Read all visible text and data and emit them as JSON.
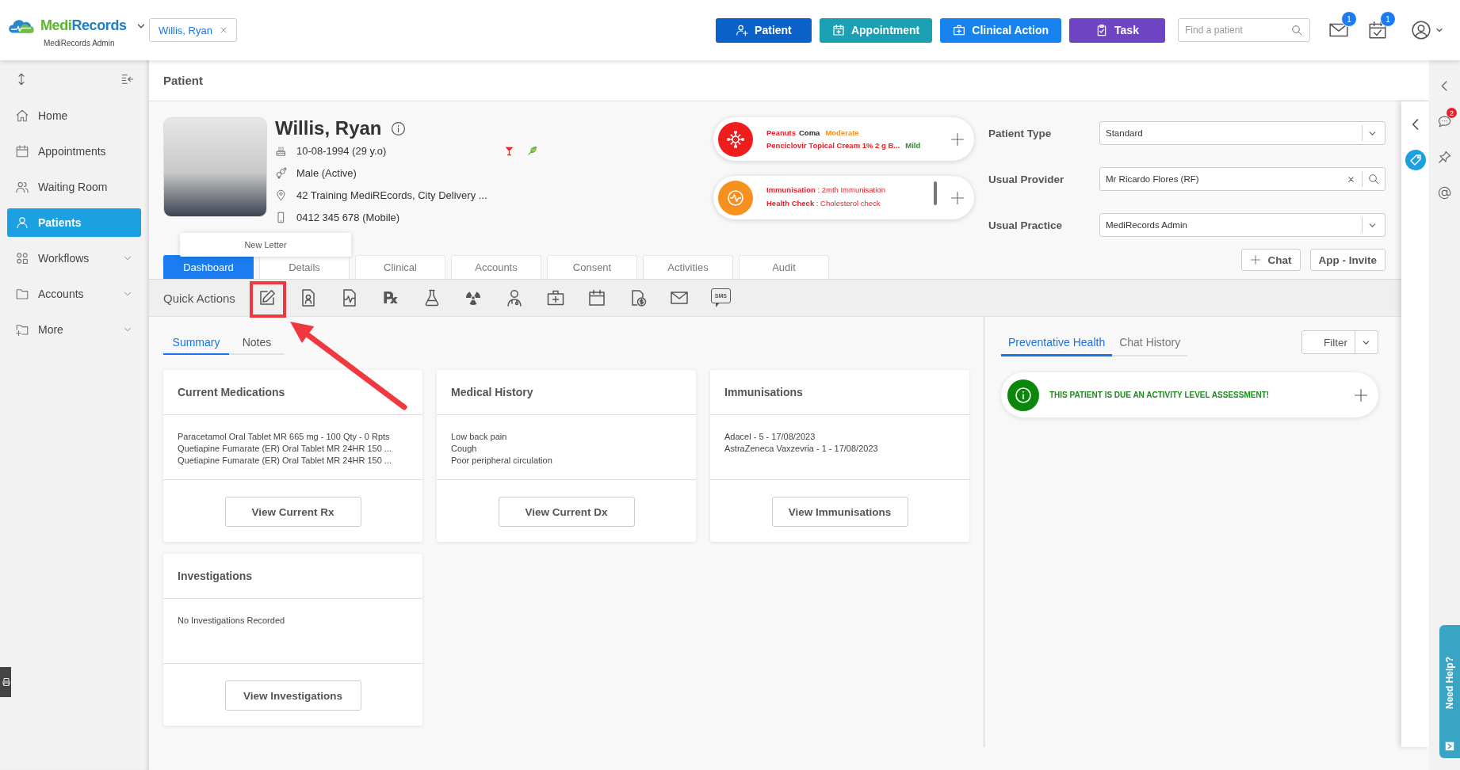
{
  "header": {
    "brand_first": "Medi",
    "brand_second": "Records",
    "organisation": "MediRecords Admin",
    "patient_tab": "Willis, Ryan",
    "actions": [
      {
        "label": "Patient",
        "color": "#0a62c9"
      },
      {
        "label": "Appointment",
        "color": "#1aa0b2"
      },
      {
        "label": "Clinical Action",
        "color": "#1783f0"
      },
      {
        "label": "Task",
        "color": "#6e43c4"
      }
    ],
    "search": {
      "placeholder": "Find a patient"
    },
    "notifications": [
      {
        "count": "1"
      },
      {
        "count": "1"
      }
    ]
  },
  "sidebar": {
    "items": [
      {
        "label": "Home",
        "selected": false,
        "expandable": false
      },
      {
        "label": "Appointments",
        "selected": false,
        "expandable": false
      },
      {
        "label": "Waiting Room",
        "selected": false,
        "expandable": false
      },
      {
        "label": "Patients",
        "selected": true,
        "expandable": false
      },
      {
        "label": "Workflows",
        "selected": false,
        "expandable": true
      },
      {
        "label": "Accounts",
        "selected": false,
        "expandable": true
      },
      {
        "label": "More",
        "selected": false,
        "expandable": true
      }
    ]
  },
  "page_title": "Patient",
  "patient": {
    "name": "Willis, Ryan",
    "dob": "10-08-1994 (29 y.o)",
    "gender": "Male (Active)",
    "address": "42 Training MediREcords, City Delivery ...",
    "phone": "0412 345 678 (Mobile)"
  },
  "allergies": [
    {
      "substance": "Peanuts",
      "reaction": "Coma",
      "severity": "Moderate",
      "color": "#f7931e"
    },
    {
      "substance": "Penciclovir Topical Cream 1% 2 g B...",
      "severity": "Mild",
      "color": "#2e8b2e"
    }
  ],
  "reminders": [
    "**Immunisation** : 2mth Immunisation",
    "**Health Check** : Cholesterol check"
  ],
  "fields": [
    {
      "label": "Patient Type",
      "value": "Standard",
      "kind": "select"
    },
    {
      "label": "Usual Provider",
      "value": "Mr Ricardo Flores (RF)",
      "kind": "search"
    },
    {
      "label": "Usual Practice",
      "value": "MediRecords Admin",
      "kind": "select"
    }
  ],
  "buttons": [
    {
      "label": "Chat",
      "kind": "add"
    },
    {
      "label": "App - Invite",
      "kind": "plain"
    }
  ],
  "tabs": [
    {
      "label": "Dashboard",
      "selected": true
    },
    {
      "label": "Details",
      "selected": false
    },
    {
      "label": "Clinical",
      "selected": false
    },
    {
      "label": "Accounts",
      "selected": false
    },
    {
      "label": "Consent",
      "selected": false
    },
    {
      "label": "Activities",
      "selected": false
    },
    {
      "label": "Audit",
      "selected": false
    }
  ],
  "tooltip": "New Letter",
  "quick_actions": {
    "label": "Quick Actions",
    "rx_symbol": "℞",
    "sms_label": "SMS"
  },
  "summary_tabs": [
    {
      "label": "Summary",
      "selected": true
    },
    {
      "label": "Notes",
      "selected": false
    }
  ],
  "cards": [
    {
      "title": "Current Medications",
      "lines": [
        "Paracetamol Oral Tablet MR 665 mg - 100 Qty - 0 Rpts",
        "Quetiapine Fumarate (ER) Oral Tablet MR 24HR 150 ...",
        "Quetiapine Fumarate (ER) Oral Tablet MR 24HR 150 ..."
      ],
      "button": "View Current Rx"
    },
    {
      "title": "Medical History",
      "lines": [
        "Low back pain",
        "Cough",
        "Poor peripheral circulation"
      ],
      "button": "View Current Dx"
    },
    {
      "title": "Immunisations",
      "lines": [
        "Adacel - 5 - 17/08/2023",
        "AstraZeneca Vaxzevria - 1 - 17/08/2023"
      ],
      "button": "View Immunisations"
    },
    {
      "title": "Investigations",
      "lines": [
        "No Investigations Recorded"
      ],
      "button": "View Investigations"
    }
  ],
  "right_panel": {
    "tabs": [
      {
        "label": "Preventative Health",
        "selected": true
      },
      {
        "label": "Chat History",
        "selected": false
      }
    ],
    "filter": "Filter",
    "alerts": [
      "THIS PATIENT IS DUE AN ACTIVITY LEVEL ASSESSMENT!"
    ]
  },
  "rail": {
    "chat_count": "2"
  },
  "help": "Need Help?"
}
